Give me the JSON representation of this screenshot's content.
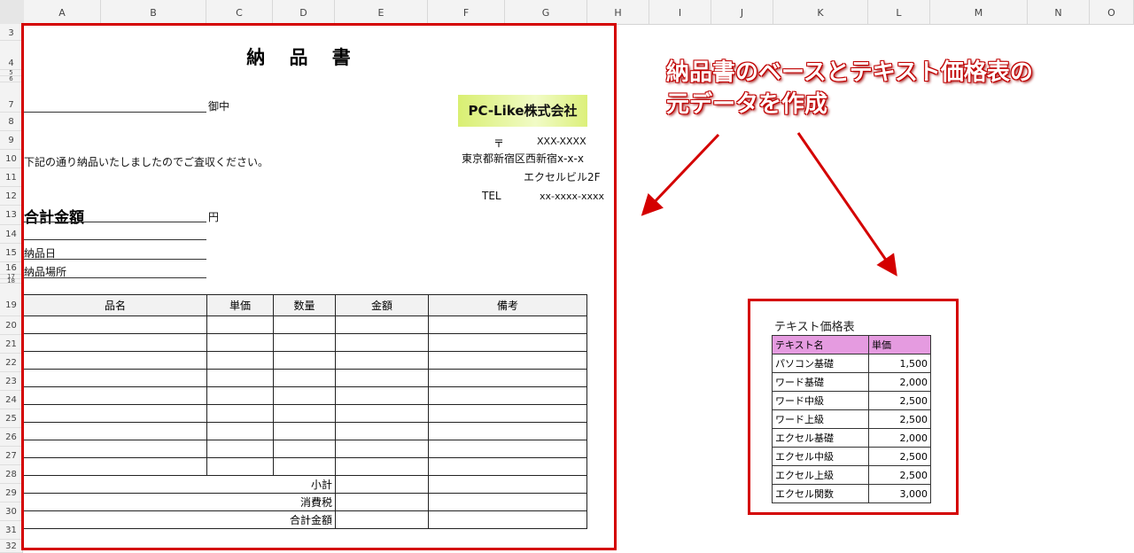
{
  "columns": [
    "A",
    "B",
    "C",
    "D",
    "E",
    "F",
    "G",
    "H",
    "I",
    "J",
    "K",
    "L",
    "M",
    "N",
    "O"
  ],
  "rows": [
    "3",
    "4",
    "5",
    "6",
    "7",
    "8",
    "9",
    "10",
    "11",
    "12",
    "13",
    "14",
    "15",
    "16",
    "17",
    "18",
    "19",
    "20",
    "21",
    "22",
    "23",
    "24",
    "25",
    "26",
    "27",
    "28",
    "29",
    "30",
    "31",
    "32"
  ],
  "invoice": {
    "title": "納 品 書",
    "recipient_suffix": "御中",
    "intro": "下記の通り納品いたしましたのでご査収ください。",
    "total_label": "合計金額",
    "total_unit": "円",
    "delivery_date_label": "納品日",
    "delivery_place_label": "納品場所",
    "company_logo": "PC-Like株式会社",
    "postal_mark": "〒",
    "postal_code": "XXX-XXXX",
    "address1": "東京都新宿区西新宿x-x-x",
    "address2": "エクセルビル2F",
    "tel_label": "TEL",
    "tel": "xx-xxxx-xxxx",
    "headers": [
      "品名",
      "単価",
      "数量",
      "金額",
      "備考"
    ],
    "subtotal_label": "小計",
    "tax_label": "消費税",
    "grand_total_label": "合計金額"
  },
  "callout": {
    "line1": "納品書のベースとテキスト価格表の",
    "line2": "元データを作成"
  },
  "price_table": {
    "title": "テキスト価格表",
    "headers": [
      "テキスト名",
      "単価"
    ],
    "rows": [
      {
        "name": "パソコン基礎",
        "price": "1,500"
      },
      {
        "name": "ワード基礎",
        "price": "2,000"
      },
      {
        "name": "ワード中級",
        "price": "2,500"
      },
      {
        "name": "ワード上級",
        "price": "2,500"
      },
      {
        "name": "エクセル基礎",
        "price": "2,000"
      },
      {
        "name": "エクセル中級",
        "price": "2,500"
      },
      {
        "name": "エクセル上級",
        "price": "2,500"
      },
      {
        "name": "エクセル関数",
        "price": "3,000"
      }
    ]
  },
  "colors": {
    "frame": "#d40000",
    "header_fill": "#e59be0",
    "logo_fill": "#d9ef72"
  }
}
